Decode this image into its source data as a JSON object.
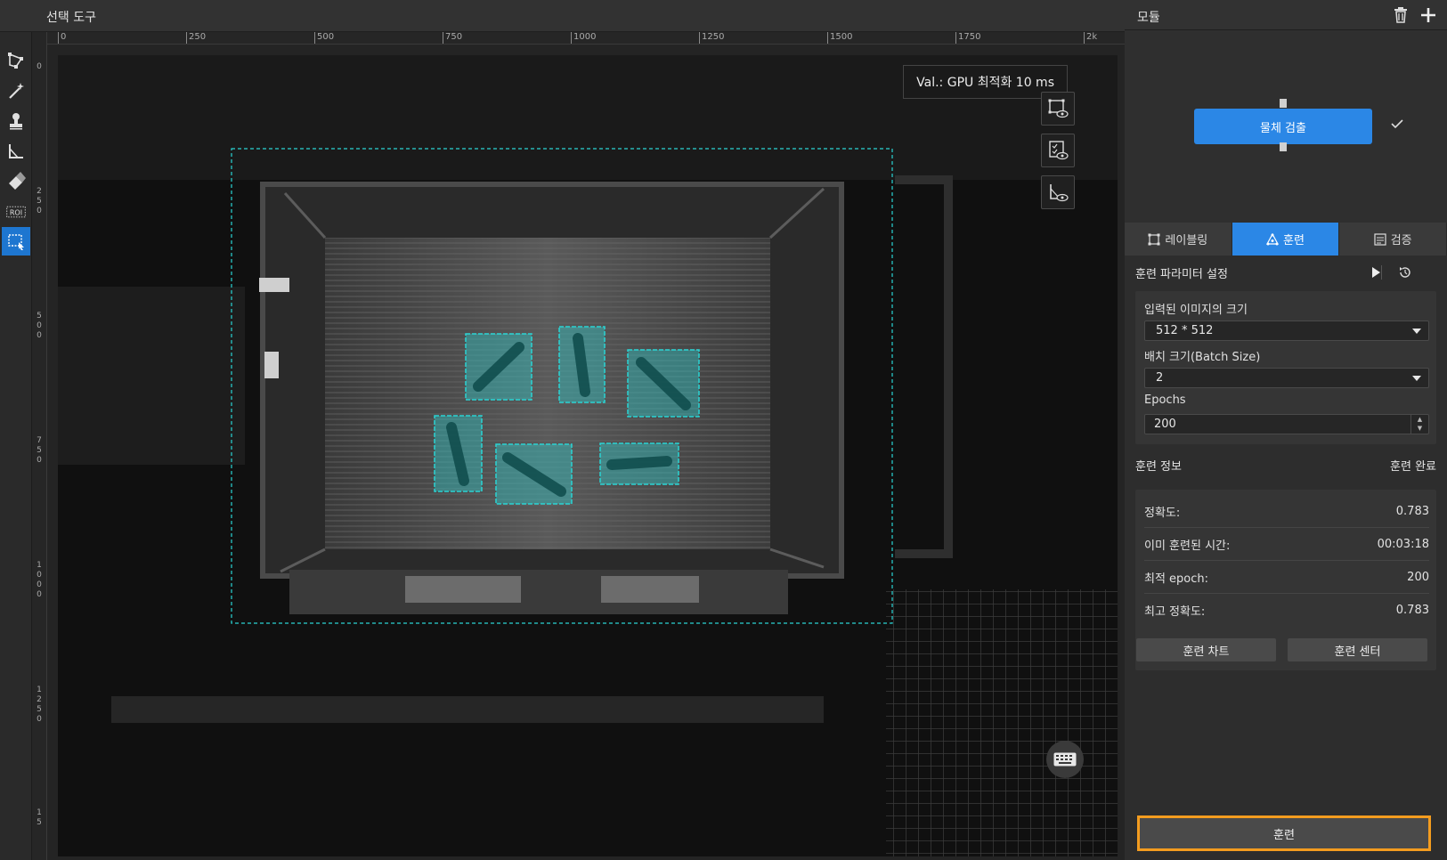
{
  "workspace": {
    "title": "선택 도구",
    "ruler_h": [
      "0",
      "250",
      "500",
      "750",
      "1000",
      "1250",
      "1500",
      "1750",
      "2k"
    ],
    "ruler_v": [
      "0",
      "2\n5\n0",
      "5\n0\n0",
      "7\n5\n0",
      "1\n0\n0\n0",
      "1\n2\n5\n0",
      "1\n5"
    ],
    "val_badge": "Val.:  GPU 최적화 10 ms",
    "roi_label": "ROI",
    "tools": [
      "polygon-select-icon",
      "magic-wand-icon",
      "stamp-icon",
      "corner-tool-icon",
      "eraser-icon",
      "roi-icon",
      "rect-select-icon"
    ],
    "view_buttons": [
      "show-labels-icon",
      "show-results-icon",
      "show-mask-icon"
    ],
    "detections_count": 6
  },
  "panel": {
    "title": "모듈",
    "module_node": "물체 검출",
    "tabs": [
      {
        "label": "레이블링",
        "icon": "labeling-icon"
      },
      {
        "label": "훈련",
        "icon": "train-icon"
      },
      {
        "label": "검증",
        "icon": "validate-icon"
      }
    ],
    "params_title": "훈련 파라미터 설정",
    "input_size_label": "입력된 이미지의 크기",
    "input_size_value": "512 * 512",
    "batch_label": "배치 크기(Batch Size)",
    "batch_value": "2",
    "epochs_label": "Epochs",
    "epochs_value": "200",
    "info_title": "훈련 정보",
    "info_status": "훈련 완료",
    "info": [
      {
        "label": "정확도:",
        "value": "0.783"
      },
      {
        "label": "이미 훈련된 시간:",
        "value": "00:03:18"
      },
      {
        "label": "최적 epoch:",
        "value": "200"
      },
      {
        "label": "최고 정확도:",
        "value": "0.783"
      }
    ],
    "chart_button": "훈련 차트",
    "center_button": "훈련 센터",
    "train_button": "훈련"
  },
  "colors": {
    "accent": "#2b87e6",
    "highlight": "#f39c1f",
    "detection": "#2ad4d4"
  }
}
